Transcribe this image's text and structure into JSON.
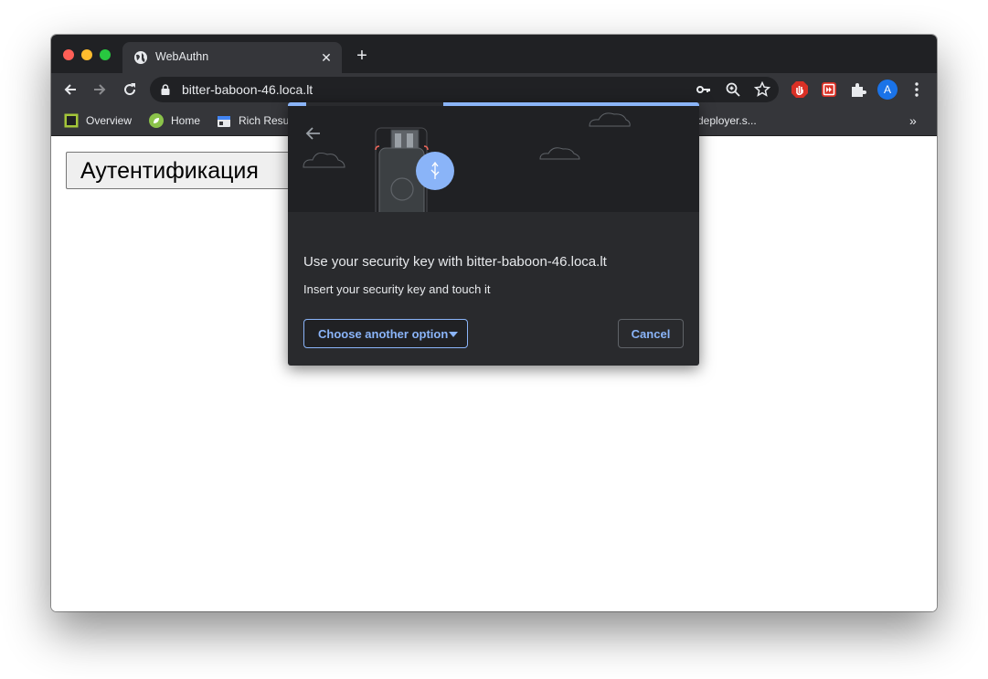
{
  "browser": {
    "tab": {
      "title": "WebAuthn",
      "close_glyph": "✕"
    },
    "new_tab_glyph": "+",
    "address_bar": {
      "url": "bitter-baboon-46.loca.lt"
    },
    "profile_initial": "A",
    "bookmarks": [
      {
        "label": "Overview",
        "icon": "overview-icon"
      },
      {
        "label": "Home",
        "icon": "home-leaf-icon"
      },
      {
        "label": "Rich Resu",
        "icon": "rich-results-icon"
      },
      {
        "label": "deployer.s...",
        "icon": ""
      }
    ],
    "bookmarks_overflow": "»"
  },
  "page": {
    "auth_button_label": "Аутентификация"
  },
  "dialog": {
    "title": "Use your security key with bitter-baboon-46.loca.lt",
    "description": "Insert your security key and touch it",
    "choose_option_label": "Choose another option",
    "cancel_label": "Cancel"
  },
  "colors": {
    "accent": "#8ab4f8",
    "dialog_bg": "#292a2d",
    "toolbar_bg": "#35363a",
    "tabstrip_bg": "#202124"
  }
}
